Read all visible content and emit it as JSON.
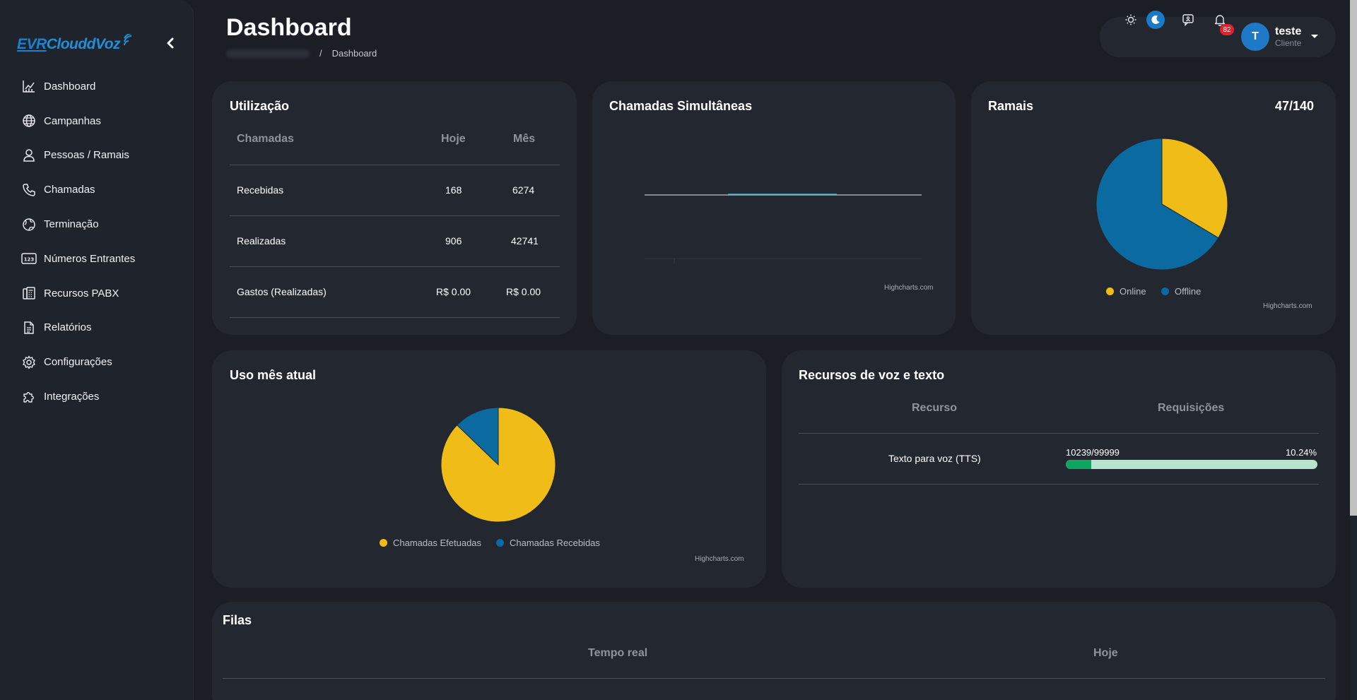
{
  "app": {
    "logo_text_prefix": "EVR",
    "logo_text_suffix": "ClouddVoz"
  },
  "sidebar": {
    "items": [
      {
        "label": "Dashboard",
        "icon": "chart-icon"
      },
      {
        "label": "Campanhas",
        "icon": "globe-icon"
      },
      {
        "label": "Pessoas / Ramais",
        "icon": "person-icon"
      },
      {
        "label": "Chamadas",
        "icon": "phone-icon"
      },
      {
        "label": "Terminação",
        "icon": "network-globe-icon"
      },
      {
        "label": "Números Entrantes",
        "icon": "numbers-123-icon"
      },
      {
        "label": "Recursos PABX",
        "icon": "pabx-icon"
      },
      {
        "label": "Relatórios",
        "icon": "document-icon"
      },
      {
        "label": "Configurações",
        "icon": "gear-icon"
      },
      {
        "label": "Integrações",
        "icon": "puzzle-icon"
      }
    ]
  },
  "header": {
    "title": "Dashboard",
    "breadcrumb_current": "Dashboard",
    "notifications_count": "82",
    "user_initial": "T",
    "user_name": "teste",
    "user_role": "Cliente"
  },
  "utilizacao": {
    "title": "Utilização",
    "columns": [
      "Chamadas",
      "Hoje",
      "Mês"
    ],
    "rows": [
      {
        "label": "Recebidas",
        "hoje": "168",
        "mes": "6274"
      },
      {
        "label": "Realizadas",
        "hoje": "906",
        "mes": "42741"
      },
      {
        "label": "Gastos (Realizadas)",
        "hoje": "R$ 0.00",
        "mes": "R$ 0.00"
      }
    ]
  },
  "chamadas_simultaneas": {
    "title": "Chamadas Simultâneas",
    "credit": "Highcharts.com"
  },
  "ramais": {
    "title": "Ramais",
    "count": "47/140",
    "credit": "Highcharts.com"
  },
  "uso_mes": {
    "title": "Uso mês atual",
    "credit": "Highcharts.com"
  },
  "recursos": {
    "title": "Recursos de voz e texto",
    "columns": [
      "Recurso",
      "Requisições"
    ],
    "rows": [
      {
        "label": "Texto para voz (TTS)",
        "usage": "10239/99999",
        "percent_label": "10.24%",
        "percent": 10.24
      }
    ],
    "colors": {
      "bar_fill": "#0ea560",
      "bar_track": "#b7e4cc"
    }
  },
  "filas": {
    "title": "Filas",
    "columns": [
      "Tempo real",
      "Hoje"
    ]
  },
  "chart_data": [
    {
      "type": "line",
      "title": "Chamadas Simultâneas",
      "x": [],
      "series": [],
      "grid": true
    },
    {
      "type": "pie",
      "title": "Ramais",
      "categories": [
        "Online",
        "Offline"
      ],
      "values": [
        47,
        93
      ],
      "colors": [
        "#f0bd18",
        "#0b6aa0"
      ],
      "legend": "bottom"
    },
    {
      "type": "pie",
      "title": "Uso mês atual",
      "categories": [
        "Chamadas Efetuadas",
        "Chamadas Recebidas"
      ],
      "values": [
        42741,
        6274
      ],
      "colors": [
        "#f0bd18",
        "#0b6aa0"
      ],
      "legend": "bottom"
    }
  ]
}
